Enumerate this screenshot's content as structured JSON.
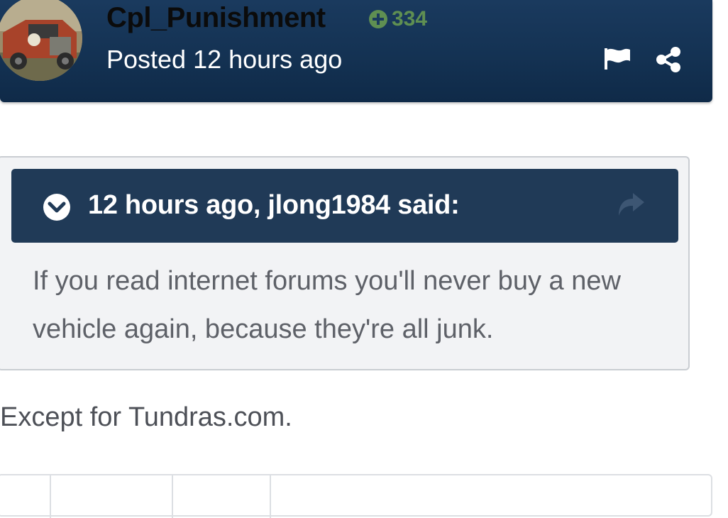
{
  "post": {
    "author": "Cpl_Punishment",
    "reputation": "334",
    "posted": "Posted 12 hours ago",
    "icons": [
      "flag-icon",
      "share-icon",
      "reputation-plus-icon"
    ]
  },
  "quote": {
    "citation": "12 hours ago, jlong1984 said:",
    "body": "If you read internet forums you'll never buy a new vehicle again, because they're all junk.",
    "icons": [
      "expand-icon",
      "go-to-quoted-post-icon"
    ]
  },
  "reply": {
    "text": "Except for Tundras.com."
  },
  "colors": {
    "header_bg": "#143253",
    "quote_head_bg": "#203a57",
    "reputation_green": "#5f8f52",
    "quote_bg": "#f2f3f5"
  }
}
